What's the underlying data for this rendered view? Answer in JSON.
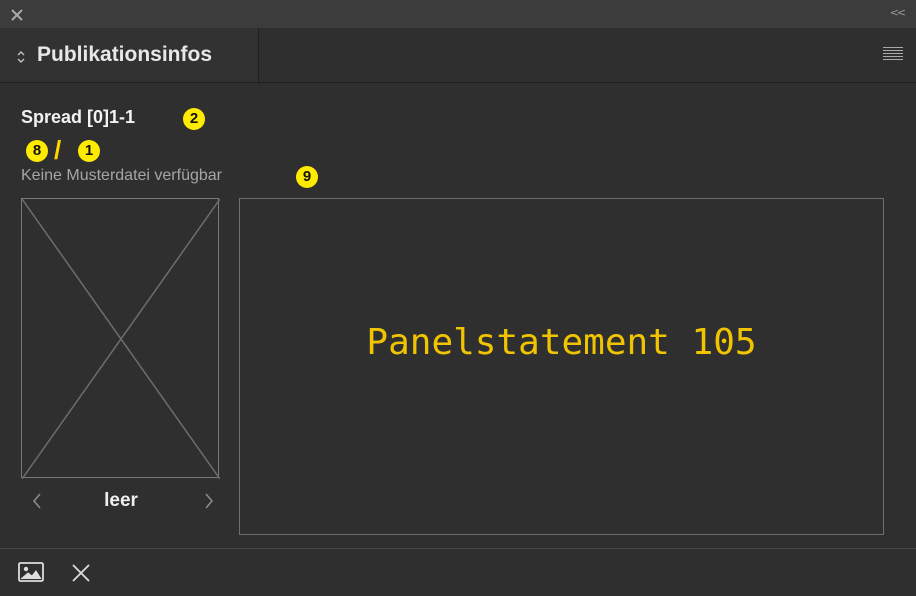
{
  "panel": {
    "tab_title": "Publikationsinfos"
  },
  "content": {
    "spread_title": "Spread [0]1-1",
    "spread_badge": "2",
    "page_badge_left": "8",
    "separator": "/",
    "page_badge_right": "1",
    "master_status": "Keine Musterdatei verfügbar",
    "master_badge": "9",
    "thumbnail_label": "leer",
    "statement": "Panelstatement 105"
  },
  "icons": {
    "close": "close-icon",
    "collapse": "collapse-icon",
    "tab_toggle": "updown-chevron-icon",
    "menu": "hamburger-menu-icon",
    "prev": "chevron-left-icon",
    "next": "chevron-right-icon",
    "image": "image-icon",
    "delete": "x-icon"
  },
  "colors": {
    "background": "#2f2f2f",
    "badge": "#ffeb00",
    "statement": "#f0c400"
  }
}
